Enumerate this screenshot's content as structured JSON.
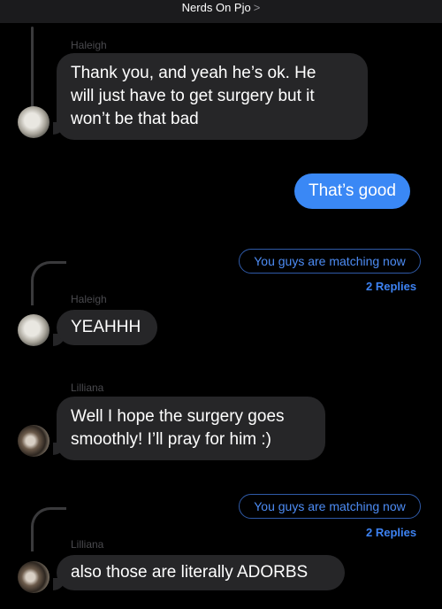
{
  "header": {
    "title": "Nerds On Pjo",
    "chevron": ">"
  },
  "messages": [
    {
      "sender": "Haleigh",
      "text_lines": [
        "Thank you, and yeah he’s ok. He",
        "will just have to get surgery but it",
        "won’t be that bad"
      ]
    },
    {
      "sender": "",
      "text": "That’s good"
    },
    {
      "sender": "Haleigh",
      "text": "YEAHHH"
    },
    {
      "sender": "Lilliana",
      "text_lines": [
        "Well I hope the surgery goes",
        "smoothly! I’ll pray for him :)"
      ]
    },
    {
      "sender": "Lilliana",
      "text": "also those are literally ADORBS"
    }
  ],
  "threads": [
    {
      "preview": "You guys are matching now",
      "replies": "2 Replies"
    },
    {
      "preview": "You guys are matching now",
      "replies": "2 Replies"
    }
  ],
  "colors": {
    "outgoing_bubble": "#3a88f5",
    "incoming_bubble": "#262628",
    "link_blue": "#3d82f2"
  }
}
